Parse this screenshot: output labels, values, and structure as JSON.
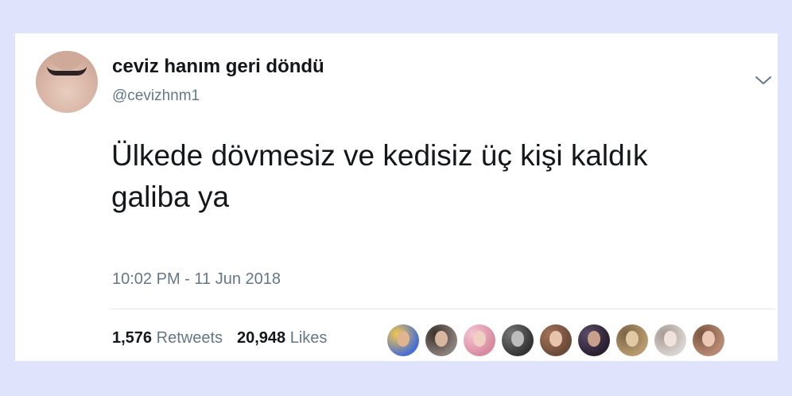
{
  "author": {
    "display_name": "ceviz hanım geri döndü",
    "handle": "@cevizhnm1",
    "avatar_icon": "avatar-choker-photo"
  },
  "tweet": {
    "text": "Ülkede dövmesiz ve kedisiz üç kişi kaldık galiba ya",
    "timestamp": "10:02 PM - 11 Jun 2018"
  },
  "stats": {
    "retweets_count": "1,576",
    "retweets_label": "Retweets",
    "likes_count": "20,948",
    "likes_label": "Likes"
  },
  "likers": [
    {
      "bg": "#4a6fd1",
      "accent": "#f2c94c",
      "face": "#e0b48f"
    },
    {
      "bg": "#8b7f7a",
      "accent": "#3a302c",
      "face": "#d9b6a0"
    },
    {
      "bg": "#d88aa0",
      "accent": "#f4c6d2",
      "face": "#f0d0c2"
    },
    {
      "bg": "#333333",
      "accent": "#777777",
      "face": "#bdbdbd"
    },
    {
      "bg": "#6b4a3a",
      "accent": "#a27357",
      "face": "#e8c4ad"
    },
    {
      "bg": "#2a2030",
      "accent": "#5b4a6a",
      "face": "#c9a08a"
    },
    {
      "bg": "#b89a6e",
      "accent": "#7a6446",
      "face": "#e2c9a6"
    },
    {
      "bg": "#d9d2cf",
      "accent": "#a89b95",
      "face": "#efe3dc"
    },
    {
      "bg": "#b88a73",
      "accent": "#7a5540",
      "face": "#ecc7b3"
    }
  ],
  "colors": {
    "background": "#dfe3fb",
    "card": "#ffffff",
    "text_primary": "#14171a",
    "text_secondary": "#657786",
    "divider": "#e1e8ed"
  },
  "icons": {
    "menu": "chevron-down-icon"
  }
}
